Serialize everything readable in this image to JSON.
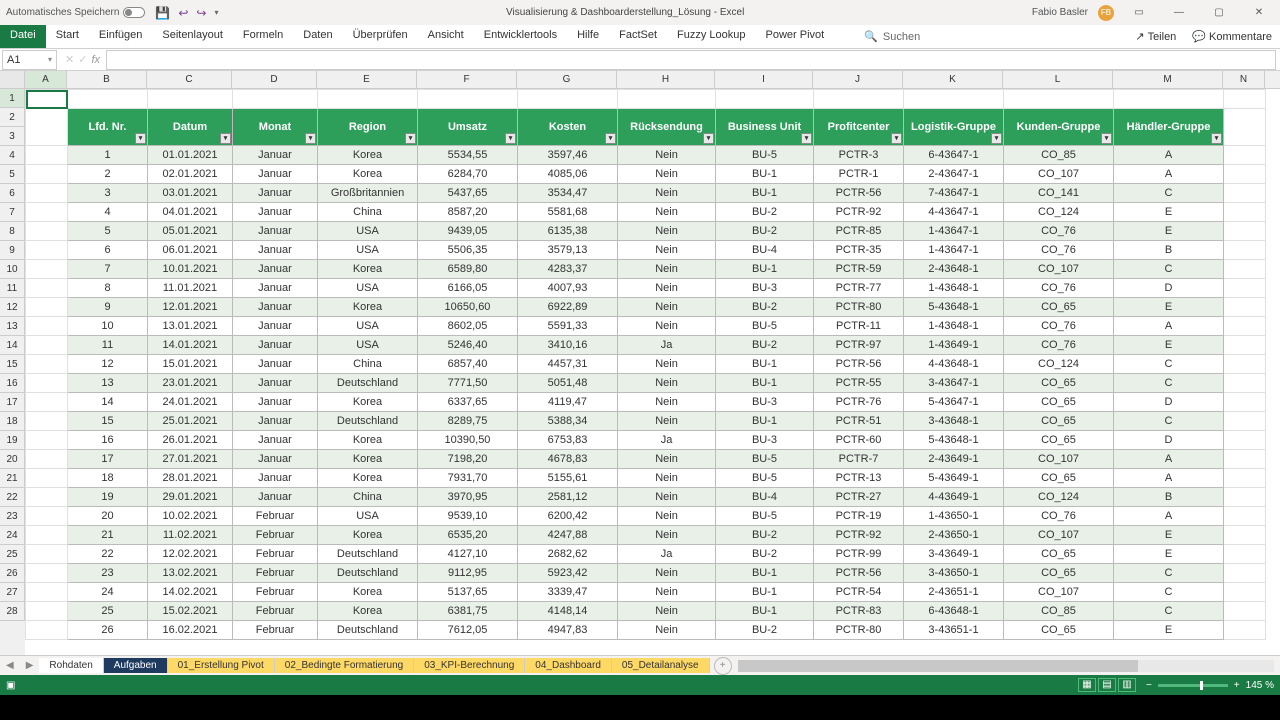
{
  "title": {
    "autosave": "Automatisches Speichern",
    "doc": "Visualisierung & Dashboarderstellung_Lösung - Excel",
    "user": "Fabio Basler",
    "initials": "FB"
  },
  "ribbon": {
    "file": "Datei",
    "tabs": [
      "Start",
      "Einfügen",
      "Seitenlayout",
      "Formeln",
      "Daten",
      "Überprüfen",
      "Ansicht",
      "Entwicklertools",
      "Hilfe",
      "FactSet",
      "Fuzzy Lookup",
      "Power Pivot"
    ],
    "search": "Suchen",
    "share": "Teilen",
    "comments": "Kommentare"
  },
  "namebox": "A1",
  "cols": [
    "A",
    "B",
    "C",
    "D",
    "E",
    "F",
    "G",
    "H",
    "I",
    "J",
    "K",
    "L",
    "M",
    "N"
  ],
  "colw": [
    "cA",
    "cB",
    "cC",
    "cD",
    "cE",
    "cF",
    "cG",
    "cH",
    "cI",
    "cJ",
    "cK",
    "cL",
    "cM",
    "cN"
  ],
  "rownums": [
    "1",
    "2",
    "3",
    "4",
    "5",
    "6",
    "7",
    "8",
    "9",
    "10",
    "11",
    "12",
    "13",
    "14",
    "15",
    "16",
    "17",
    "18",
    "19",
    "20",
    "21",
    "22",
    "23",
    "24",
    "25",
    "26",
    "27",
    "28"
  ],
  "headers": [
    "Lfd. Nr.",
    "Datum",
    "Monat",
    "Region",
    "Umsatz",
    "Kosten",
    "Rücksendung",
    "Business Unit",
    "Profitcenter",
    "Logistik-Gruppe",
    "Kunden-Gruppe",
    "Händler-Gruppe"
  ],
  "rows": [
    [
      "1",
      "01.01.2021",
      "Januar",
      "Korea",
      "5534,55",
      "3597,46",
      "Nein",
      "BU-5",
      "PCTR-3",
      "6-43647-1",
      "CO_85",
      "A"
    ],
    [
      "2",
      "02.01.2021",
      "Januar",
      "Korea",
      "6284,70",
      "4085,06",
      "Nein",
      "BU-1",
      "PCTR-1",
      "2-43647-1",
      "CO_107",
      "A"
    ],
    [
      "3",
      "03.01.2021",
      "Januar",
      "Großbritannien",
      "5437,65",
      "3534,47",
      "Nein",
      "BU-1",
      "PCTR-56",
      "7-43647-1",
      "CO_141",
      "C"
    ],
    [
      "4",
      "04.01.2021",
      "Januar",
      "China",
      "8587,20",
      "5581,68",
      "Nein",
      "BU-2",
      "PCTR-92",
      "4-43647-1",
      "CO_124",
      "E"
    ],
    [
      "5",
      "05.01.2021",
      "Januar",
      "USA",
      "9439,05",
      "6135,38",
      "Nein",
      "BU-2",
      "PCTR-85",
      "1-43647-1",
      "CO_76",
      "E"
    ],
    [
      "6",
      "06.01.2021",
      "Januar",
      "USA",
      "5506,35",
      "3579,13",
      "Nein",
      "BU-4",
      "PCTR-35",
      "1-43647-1",
      "CO_76",
      "B"
    ],
    [
      "7",
      "10.01.2021",
      "Januar",
      "Korea",
      "6589,80",
      "4283,37",
      "Nein",
      "BU-1",
      "PCTR-59",
      "2-43648-1",
      "CO_107",
      "C"
    ],
    [
      "8",
      "11.01.2021",
      "Januar",
      "USA",
      "6166,05",
      "4007,93",
      "Nein",
      "BU-3",
      "PCTR-77",
      "1-43648-1",
      "CO_76",
      "D"
    ],
    [
      "9",
      "12.01.2021",
      "Januar",
      "Korea",
      "10650,60",
      "6922,89",
      "Nein",
      "BU-2",
      "PCTR-80",
      "5-43648-1",
      "CO_65",
      "E"
    ],
    [
      "10",
      "13.01.2021",
      "Januar",
      "USA",
      "8602,05",
      "5591,33",
      "Nein",
      "BU-5",
      "PCTR-11",
      "1-43648-1",
      "CO_76",
      "A"
    ],
    [
      "11",
      "14.01.2021",
      "Januar",
      "USA",
      "5246,40",
      "3410,16",
      "Ja",
      "BU-2",
      "PCTR-97",
      "1-43649-1",
      "CO_76",
      "E"
    ],
    [
      "12",
      "15.01.2021",
      "Januar",
      "China",
      "6857,40",
      "4457,31",
      "Nein",
      "BU-1",
      "PCTR-56",
      "4-43648-1",
      "CO_124",
      "C"
    ],
    [
      "13",
      "23.01.2021",
      "Januar",
      "Deutschland",
      "7771,50",
      "5051,48",
      "Nein",
      "BU-1",
      "PCTR-55",
      "3-43647-1",
      "CO_65",
      "C"
    ],
    [
      "14",
      "24.01.2021",
      "Januar",
      "Korea",
      "6337,65",
      "4119,47",
      "Nein",
      "BU-3",
      "PCTR-76",
      "5-43647-1",
      "CO_65",
      "D"
    ],
    [
      "15",
      "25.01.2021",
      "Januar",
      "Deutschland",
      "8289,75",
      "5388,34",
      "Nein",
      "BU-1",
      "PCTR-51",
      "3-43648-1",
      "CO_65",
      "C"
    ],
    [
      "16",
      "26.01.2021",
      "Januar",
      "Korea",
      "10390,50",
      "6753,83",
      "Ja",
      "BU-3",
      "PCTR-60",
      "5-43648-1",
      "CO_65",
      "D"
    ],
    [
      "17",
      "27.01.2021",
      "Januar",
      "Korea",
      "7198,20",
      "4678,83",
      "Nein",
      "BU-5",
      "PCTR-7",
      "2-43649-1",
      "CO_107",
      "A"
    ],
    [
      "18",
      "28.01.2021",
      "Januar",
      "Korea",
      "7931,70",
      "5155,61",
      "Nein",
      "BU-5",
      "PCTR-13",
      "5-43649-1",
      "CO_65",
      "A"
    ],
    [
      "19",
      "29.01.2021",
      "Januar",
      "China",
      "3970,95",
      "2581,12",
      "Nein",
      "BU-4",
      "PCTR-27",
      "4-43649-1",
      "CO_124",
      "B"
    ],
    [
      "20",
      "10.02.2021",
      "Februar",
      "USA",
      "9539,10",
      "6200,42",
      "Nein",
      "BU-5",
      "PCTR-19",
      "1-43650-1",
      "CO_76",
      "A"
    ],
    [
      "21",
      "11.02.2021",
      "Februar",
      "Korea",
      "6535,20",
      "4247,88",
      "Nein",
      "BU-2",
      "PCTR-92",
      "2-43650-1",
      "CO_107",
      "E"
    ],
    [
      "22",
      "12.02.2021",
      "Februar",
      "Deutschland",
      "4127,10",
      "2682,62",
      "Ja",
      "BU-2",
      "PCTR-99",
      "3-43649-1",
      "CO_65",
      "E"
    ],
    [
      "23",
      "13.02.2021",
      "Februar",
      "Deutschland",
      "9112,95",
      "5923,42",
      "Nein",
      "BU-1",
      "PCTR-56",
      "3-43650-1",
      "CO_65",
      "C"
    ],
    [
      "24",
      "14.02.2021",
      "Februar",
      "Korea",
      "5137,65",
      "3339,47",
      "Nein",
      "BU-1",
      "PCTR-54",
      "2-43651-1",
      "CO_107",
      "C"
    ],
    [
      "25",
      "15.02.2021",
      "Februar",
      "Korea",
      "6381,75",
      "4148,14",
      "Nein",
      "BU-1",
      "PCTR-83",
      "6-43648-1",
      "CO_85",
      "C"
    ],
    [
      "26",
      "16.02.2021",
      "Februar",
      "Deutschland",
      "7612,05",
      "4947,83",
      "Nein",
      "BU-2",
      "PCTR-80",
      "3-43651-1",
      "CO_65",
      "E"
    ]
  ],
  "sheets": {
    "plain": "Rohdaten",
    "active": "Aufgaben",
    "yellow": [
      "01_Erstellung Pivot",
      "02_Bedingte Formatierung",
      "03_KPI-Berechnung",
      "04_Dashboard",
      "05_Detailanalyse"
    ]
  },
  "status": {
    "zoom": "145 %"
  }
}
